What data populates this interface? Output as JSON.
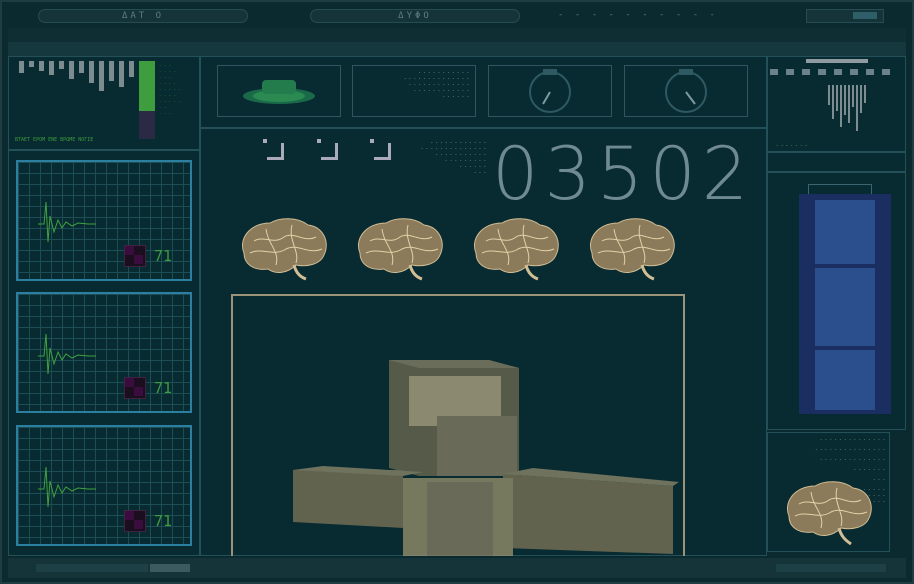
{
  "window": {
    "tabs": [
      {
        "label": "ΔΑΤ Ο"
      },
      {
        "label": "ΔΥΦΟ"
      },
      {
        "label": "- - - - - - - - - -"
      }
    ]
  },
  "left_panel": {
    "legend_text": "ΒΤΑΕΤ ΕΡΟΜ ΕΝΕ ΒΡΩΜΕ ΝΟΓΙΕ",
    "side_labels": [
      "- - -",
      "- - - -",
      "- - -",
      "- - - -",
      "- - - - -",
      "- - - -",
      "- - - - -",
      "- -",
      "- - -"
    ]
  },
  "monitors": [
    {
      "value": "71"
    },
    {
      "value": "71"
    },
    {
      "value": "71"
    }
  ],
  "top_strip": {
    "info_lines": [
      "- - - - - - - - - - -",
      "- - - - - - - - - - - - - -",
      "- - - - - - - - - - - - -",
      "- - - - - - - - - - - -",
      "- - - - - -"
    ]
  },
  "center": {
    "counter": "03502",
    "notes": [
      "- - - - - - - - - - - -",
      "- - - - - - - - - - - - - -",
      "- - - - - - - - - - -",
      "- - - - - - - - -",
      "- - - - - -",
      "- - -"
    ]
  },
  "right_panel": {
    "caption": "- - - - - - -",
    "info_lines": [
      "- - - - - - - - - - - - - -",
      "- - - - - - - - - - - - - - -",
      "- - - - - - - - - - - - - -",
      "- - - - - - -",
      "- - -",
      "- - - - - - - - - - - - - - -",
      "- - - - - - - - - - - - - - - - -",
      "- - - - - - - - - - - - - -"
    ]
  },
  "colors": {
    "accent_green": "#3d9a3d",
    "grid_blue": "#2b7fa0",
    "bone": "#c8b58f"
  }
}
